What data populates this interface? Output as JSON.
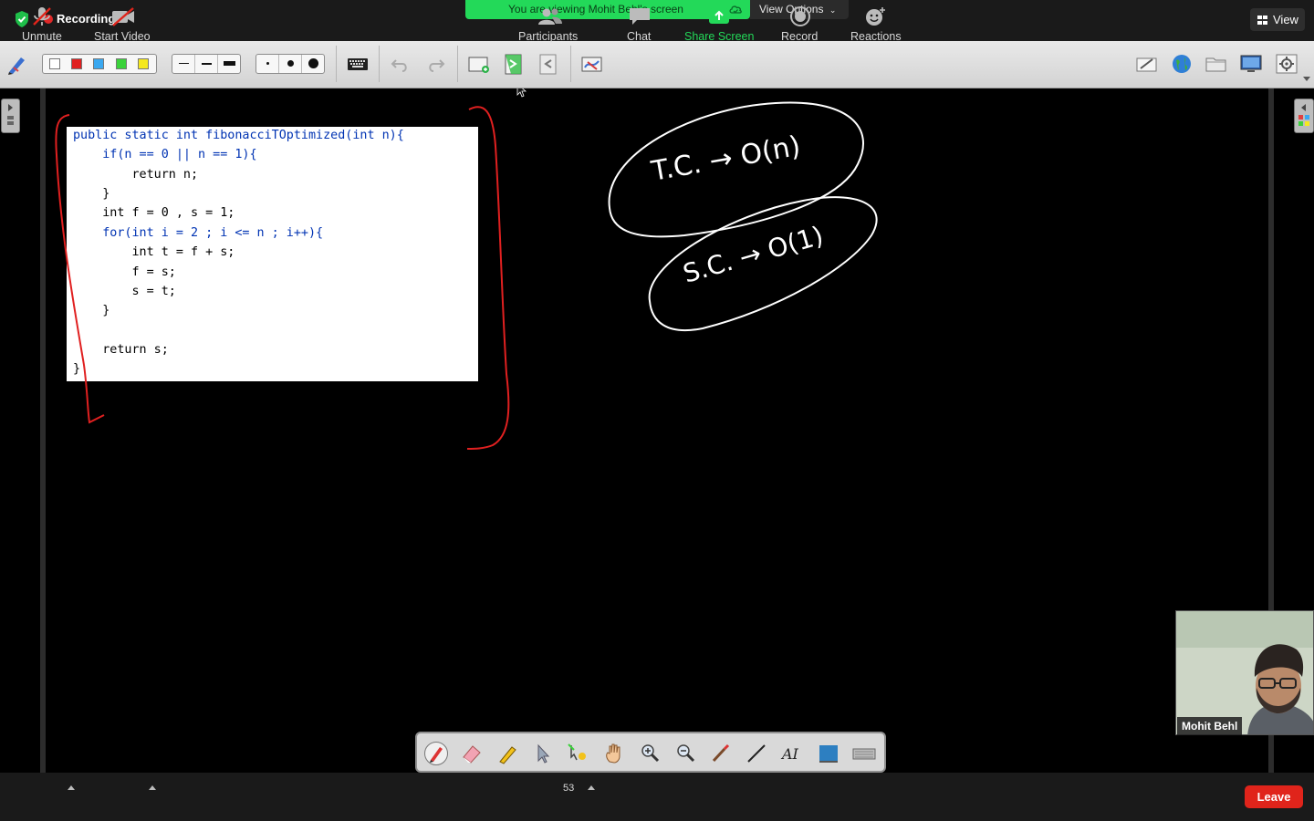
{
  "top_bar": {
    "recording_label": "Recording",
    "viewing_banner": "You are viewing Mohit Behl's screen",
    "view_options_label": "View Options",
    "view_button_label": "View"
  },
  "code": {
    "lines": [
      "public static int fibonacciTOptimized(int n){",
      "    if(n == 0 || n == 1){",
      "        return n;",
      "    }",
      "    int f = 0 , s = 1;",
      "    for(int i = 2 ; i <= n ; i++){",
      "        int t = f + s;",
      "        f = s;",
      "        s = t;",
      "    }",
      "",
      "    return s;",
      "}"
    ]
  },
  "handwriting": {
    "time_complexity": "T.C. → O(n)",
    "space_complexity": "S.C. → O(1)"
  },
  "whiteboard_toolbar": {
    "swatch_colors": [
      "#ffffff",
      "#e02020",
      "#3aa8f0",
      "#3bd23b",
      "#f5e81e"
    ],
    "icons": [
      "pen-tool-icon",
      "keyboard-icon",
      "undo-icon",
      "redo-icon",
      "new-page-icon",
      "next-page-icon",
      "previous-page-icon",
      "clear-icon",
      "pen-box-icon",
      "globe-icon",
      "folder-icon",
      "monitor-icon",
      "settings-icon"
    ]
  },
  "annotation_tools": [
    "pen-icon",
    "eraser-icon",
    "highlighter-icon",
    "select-icon",
    "spotlight-icon",
    "hand-icon",
    "zoom-in-icon",
    "zoom-out-icon",
    "brush-icon",
    "line-icon",
    "text-icon",
    "shape-icon",
    "keyboard-icon"
  ],
  "video": {
    "participant_name": "Mohit Behl"
  },
  "controls": {
    "unmute": "Unmute",
    "start_video": "Start Video",
    "participants": "Participants",
    "participant_count": "53",
    "chat": "Chat",
    "share_screen": "Share Screen",
    "record": "Record",
    "reactions": "Reactions",
    "leave": "Leave"
  },
  "colors": {
    "banner_green": "#23d959",
    "share_green": "#23d959",
    "leave_red": "#e0241b",
    "ink_red": "#e02020",
    "ink_white": "#ffffff"
  }
}
